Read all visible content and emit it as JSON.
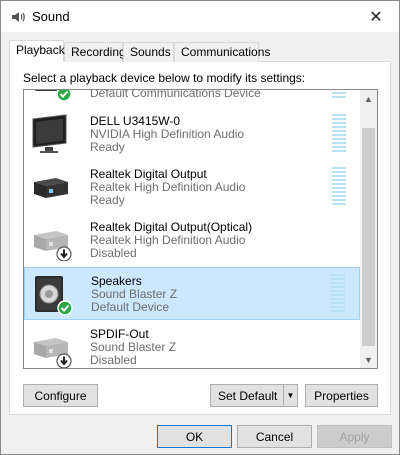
{
  "window": {
    "title": "Sound",
    "close_glyph": "✕"
  },
  "tabs": [
    {
      "label": "Playback",
      "active": true
    },
    {
      "label": "Recording",
      "active": false
    },
    {
      "label": "Sounds",
      "active": false
    },
    {
      "label": "Communications",
      "active": false
    }
  ],
  "instruction": "Select a playback device below to modify its settings:",
  "devices": [
    {
      "name": "",
      "driver": "",
      "status": "Default Communications Device",
      "icon": "headset-icon",
      "badge": "check-badge",
      "selected": false
    },
    {
      "name": "DELL U3415W-0",
      "driver": "NVIDIA High Definition Audio",
      "status": "Ready",
      "icon": "monitor-icon",
      "badge": "",
      "selected": false
    },
    {
      "name": "Realtek Digital Output",
      "driver": "Realtek High Definition Audio",
      "status": "Ready",
      "icon": "digital-output-icon",
      "badge": "",
      "selected": false
    },
    {
      "name": "Realtek Digital Output(Optical)",
      "driver": "Realtek High Definition Audio",
      "status": "Disabled",
      "icon": "digital-output-icon",
      "badge": "disabled-badge",
      "selected": false
    },
    {
      "name": "Speakers",
      "driver": "Sound Blaster Z",
      "status": "Default Device",
      "icon": "speaker-icon",
      "badge": "check-badge",
      "selected": true
    },
    {
      "name": "SPDIF-Out",
      "driver": "Sound Blaster Z",
      "status": "Disabled",
      "icon": "digital-output-icon",
      "badge": "disabled-badge",
      "selected": false
    }
  ],
  "buttons": {
    "configure": "Configure",
    "set_default": "Set Default",
    "properties": "Properties",
    "ok": "OK",
    "cancel": "Cancel",
    "apply": "Apply"
  },
  "colors": {
    "selection": "#cce8ff",
    "accent": "#0078d7",
    "check_green": "#2aa845"
  }
}
